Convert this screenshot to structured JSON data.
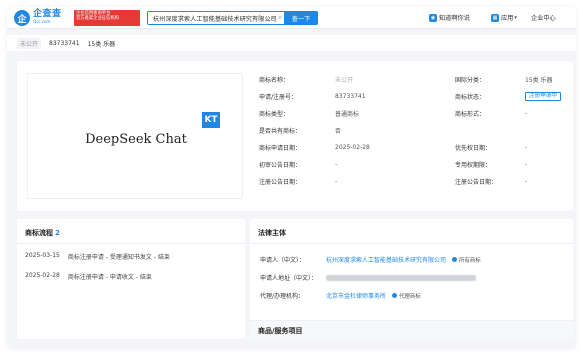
{
  "header": {
    "logo_mark": "企",
    "logo_name": "企查查",
    "logo_url": "Qcc.com",
    "badge_lines": [
      "企业信用查询平台",
      "官方备案企业征信机构"
    ],
    "search_value": "杭州深度求索人工智能基础技术研究有限公司",
    "search_button": "查一下",
    "nav_app": "知道啊你说",
    "nav_apps": "应用",
    "nav_center": "企业中心"
  },
  "subbar": {
    "status_tag": "未公开",
    "reg_no": "83733741",
    "class_label": "15类 乐器"
  },
  "trademark": {
    "image_text": "DeepSeek Chat",
    "image_mark": "KT",
    "fields": {
      "name_label": "商标名称：",
      "name_value": "未公开",
      "reg_label": "申请/注册号：",
      "reg_value": "83733741",
      "type_label": "商标类型：",
      "type_value": "普通商标",
      "share_label": "是否共有商标：",
      "share_value": "否",
      "apply_date_label": "商标申请日期：",
      "apply_date_value": "2025-02-28",
      "first_pub_label": "初审公告日期：",
      "first_pub_value": "-",
      "reg_pub_label": "注册公告日期：",
      "reg_pub_value": "-",
      "intl_class_label": "国际分类：",
      "intl_class_value": "15类 乐器",
      "status_label": "商标状态：",
      "status_value": "注册申请中",
      "form_label": "商标形式：",
      "form_value": "-",
      "priority_label": "优先权日期：",
      "priority_value": "-",
      "exclusive_label": "专用权期限：",
      "exclusive_value": "-",
      "intl_reg_label": "注册公告日期：",
      "intl_reg_value": "-"
    }
  },
  "flow": {
    "title": "商标流程",
    "count": "2",
    "items": [
      {
        "date": "2025-03-15",
        "desc": "商标注册申请 - 受理通知书发文 - 结束"
      },
      {
        "date": "2025-02-28",
        "desc": "商标注册申请 - 申请收文 - 结束"
      }
    ]
  },
  "law": {
    "title": "法律主体",
    "applicant_label": "申请人（中文）：",
    "applicant_value": "杭州深度求索人工智能基础技术研究有限公司",
    "applicant_tag": "所有商标",
    "address_label": "申请人地址（中文）：",
    "agent_label": "代理/办理机构：",
    "agent_value": "北京市金杜律师事务所",
    "agent_tag": "代理商标"
  },
  "goods": {
    "title": "商品/服务项目"
  },
  "colors": {
    "accent": "#1e88e5",
    "badge_red": "#e53935"
  }
}
